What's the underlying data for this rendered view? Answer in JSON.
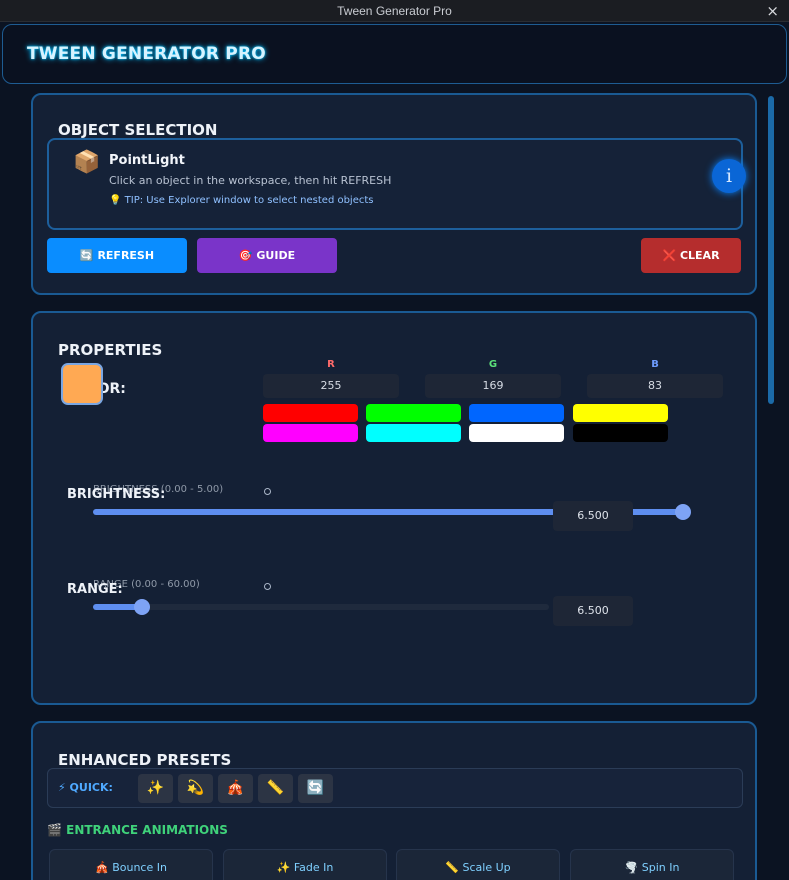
{
  "window": {
    "title": "Tween Generator Pro",
    "close_glyph": "×"
  },
  "header": {
    "title": "TWEEN GENERATOR PRO"
  },
  "object_selection": {
    "title": "OBJECT SELECTION",
    "icon": "package-icon",
    "icon_glyph": "📦",
    "object_name": "PointLight",
    "hint": "Click an object in the workspace, then hit REFRESH",
    "tip": "💡 TIP: Use Explorer window to select nested objects",
    "info_glyph": "i",
    "buttons": {
      "refresh": "🔄 REFRESH",
      "guide": "🎯 GUIDE",
      "clear": "❌ CLEAR"
    }
  },
  "properties": {
    "title": "PROPERTIES",
    "color": {
      "label": "COLOR:",
      "swatch": "#ffa953",
      "r_label": "R",
      "g_label": "G",
      "b_label": "B",
      "r": "255",
      "g": "169",
      "b": "83",
      "presets": [
        "#ff0000",
        "#00ff00",
        "#0066ff",
        "#ffff00",
        "#ff00ff",
        "#00ffff",
        "#ffffff",
        "#000000"
      ]
    },
    "brightness": {
      "label": "BRIGHTNESS:",
      "range_label": "BRIGHTNESS (0.00 - 5.00)",
      "value": "6.500",
      "fraction": 1.0
    },
    "range": {
      "label": "RANGE:",
      "range_label": "RANGE (0.00 - 60.00)",
      "value": "6.500",
      "fraction": 0.108
    }
  },
  "presets": {
    "title": "ENHANCED PRESETS",
    "quick_label": "⚡ QUICK:",
    "quick_buttons": [
      "✨",
      "💫",
      "🎪",
      "📏",
      "🔄"
    ],
    "entrance_label": "🎬 ENTRANCE ANIMATIONS",
    "entrance": [
      "🎪 Bounce In",
      "✨ Fade In",
      "📏 Scale Up",
      "🌪️ Spin In"
    ]
  },
  "colors": {
    "accent": "#1a5a93",
    "refresh": "#0a8dff",
    "guide": "#7a34c9",
    "clear": "#b52d2d"
  }
}
